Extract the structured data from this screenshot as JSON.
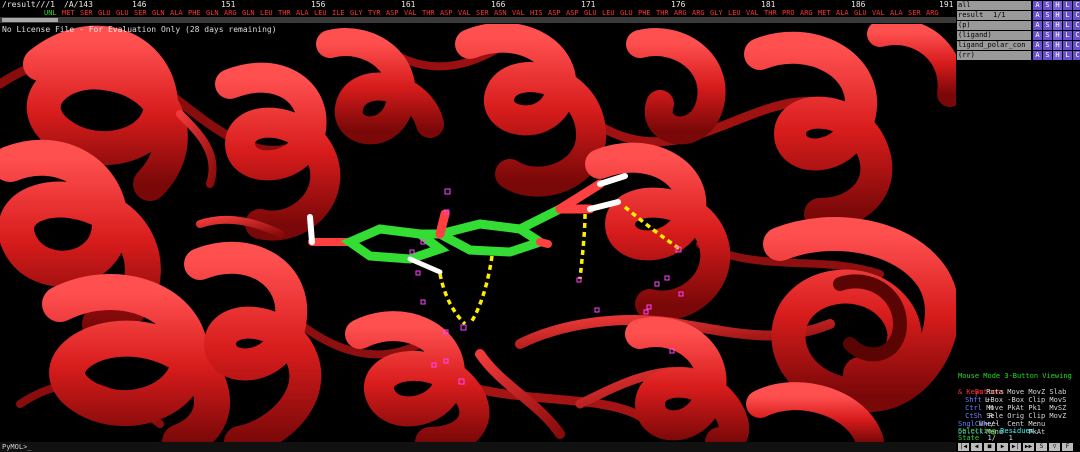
{
  "sequence": {
    "header": "/result///1",
    "chain": "/A/143",
    "numbers": [
      "146",
      "151",
      "156",
      "161",
      "166",
      "171",
      "176",
      "181",
      "186",
      "191"
    ],
    "residues": [
      "UNL",
      "MET",
      "SER",
      "GLU",
      "GLU",
      "SER",
      "GLN",
      "ALA",
      "PHE",
      "GLN",
      "ARG",
      "GLN",
      "LEU",
      "THR",
      "ALA",
      "LEU",
      "ILE",
      "GLY",
      "TYR",
      "ASP",
      "VAL",
      "THR",
      "ASP",
      "VAL",
      "SER",
      "ASN",
      "VAL",
      "HIS",
      "ASP",
      "ASP",
      "GLU",
      "LEU",
      "GLU",
      "PHE",
      "THR",
      "ARG",
      "ARG",
      "GLY",
      "LEU",
      "VAL",
      "THR",
      "PRO",
      "ARG",
      "MET",
      "ALA",
      "GLU",
      "VAL",
      "ALA",
      "SER",
      "ARG"
    ]
  },
  "viewport": {
    "eval_note": "No License File - For Evaluation Only (28 days remaining)",
    "colors": {
      "cartoon": "#e02020",
      "ligand_carbon": "#33dd33",
      "oxygen": "#ff4040",
      "hbond": "#ffee00",
      "marker": "#ff44ff"
    }
  },
  "objects": [
    {
      "name": "all",
      "state": ""
    },
    {
      "name": "result",
      "state": "1/1"
    },
    {
      "name": "(p)",
      "state": ""
    },
    {
      "name": "(ligand)",
      "state": ""
    },
    {
      "name": "ligand_polar_con",
      "state": ""
    },
    {
      "name": "(rr)",
      "state": ""
    }
  ],
  "object_buttons": [
    {
      "label": "A",
      "color": "#6d4bcf"
    },
    {
      "label": "S",
      "color": "#6d4bcf"
    },
    {
      "label": "H",
      "color": "#6d4bcf"
    },
    {
      "label": "L",
      "color": "#6d4bcf"
    },
    {
      "label": "C",
      "color": "#6d4bcf"
    }
  ],
  "mouse": {
    "title": "Mouse Mode 3-Button Viewing",
    "row1_label": "Buttons",
    "row1_l": "L",
    "row1_m": "M",
    "row1_r": "R",
    "row1_w": "Wheel",
    "row2_label": "& Keys",
    "row2_vals": "Rota Move MovZ Slab",
    "row3_label": "Shft",
    "row3_vals": "+Box -Box Clip MovS",
    "row4_label": "Ctrl",
    "row4_vals": "Move PkAt Pk1  MvSZ",
    "row5_label": "CtSh",
    "row5_vals": "Sele Orig Clip MovZ",
    "row6_label": "SnglClk",
    "row6_vals": "+/-  Cent Menu",
    "row7_label": "DblClk",
    "row7_vals": "Menu  -   PkAt",
    "selecting_label": "Selecting",
    "selecting_value": "Residues",
    "state_label": "State",
    "state_value": "1/   1"
  },
  "command": {
    "prompt": "PyMOL>_"
  },
  "playback": [
    "|◀",
    "◀",
    "■",
    "▶",
    "▶|",
    "▶▶",
    "S",
    "▽",
    "F"
  ]
}
